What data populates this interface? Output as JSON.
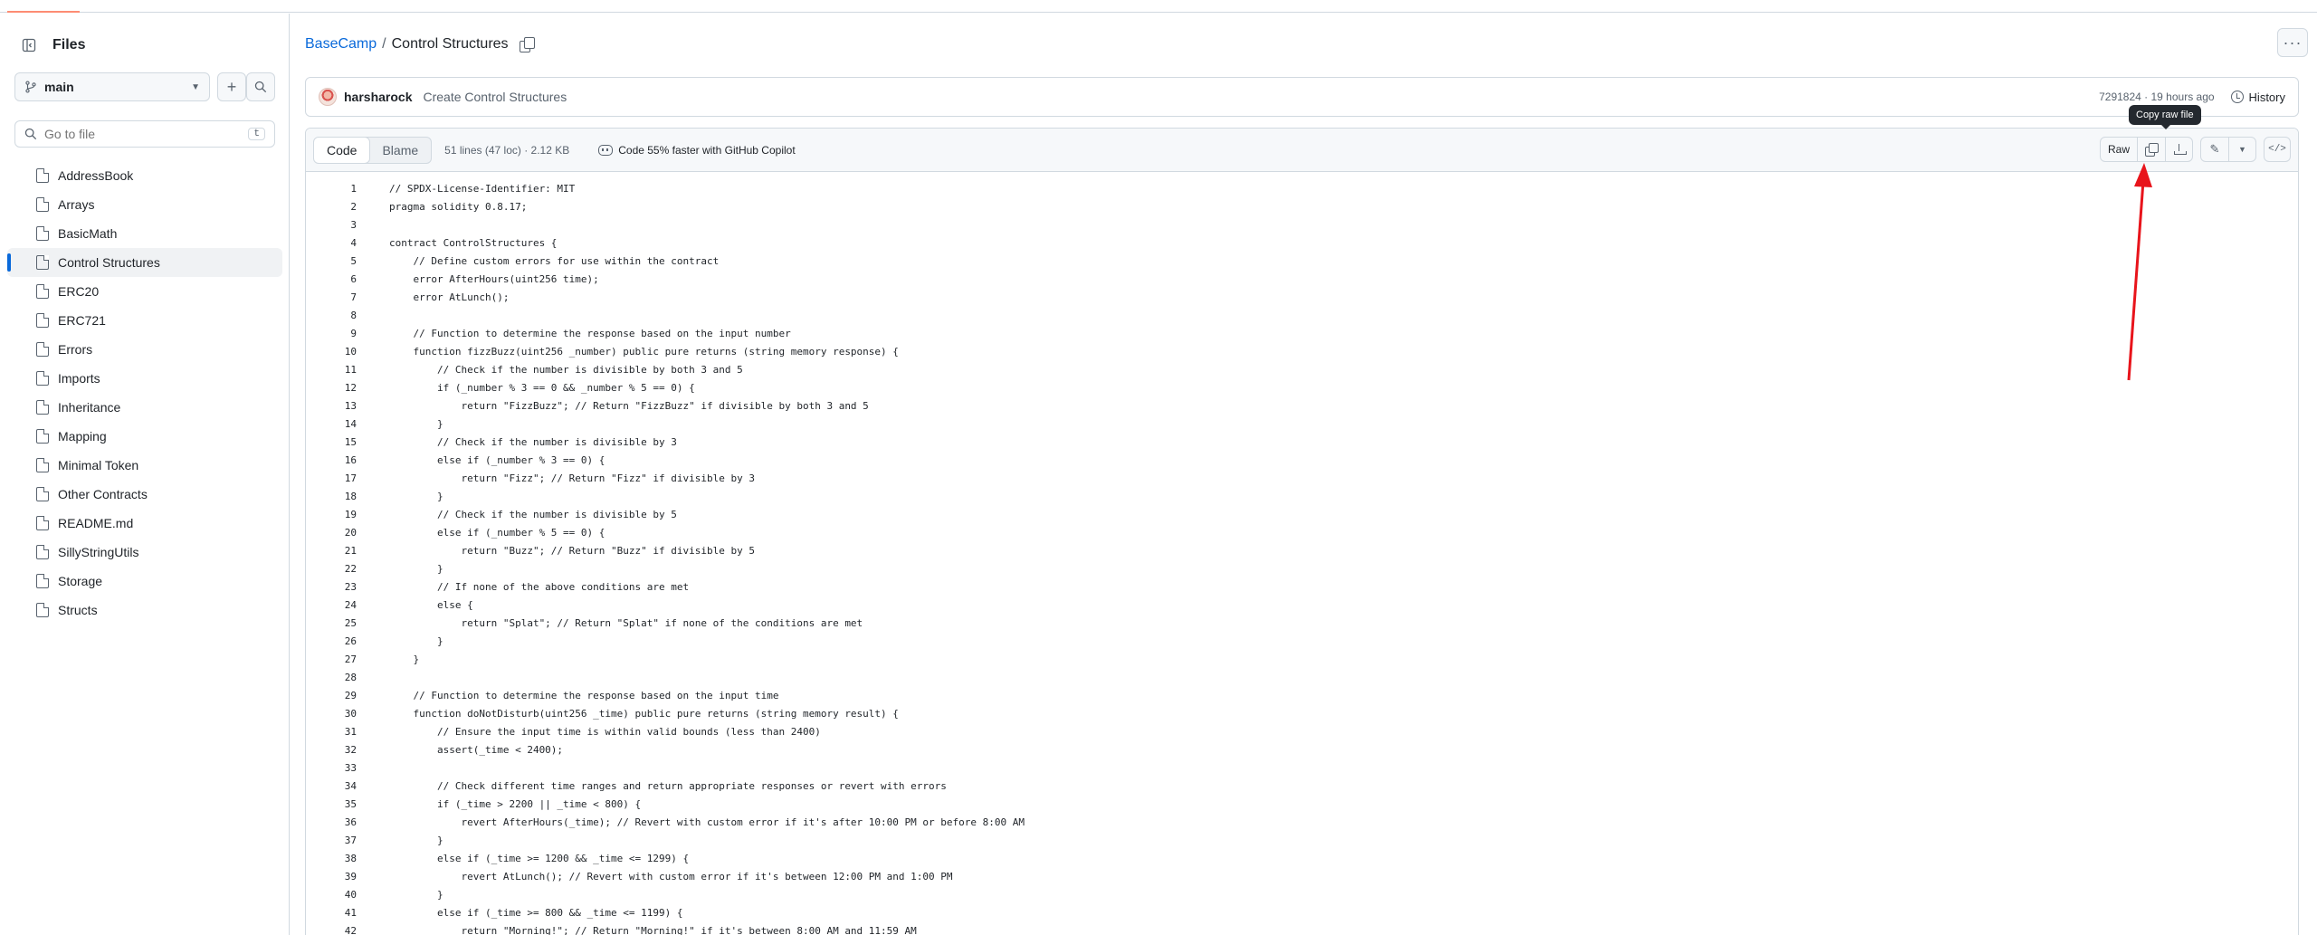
{
  "sidebar": {
    "title": "Files",
    "branch": "main",
    "goto_placeholder": "Go to file",
    "goto_kbd": "t",
    "files": [
      "AddressBook",
      "Arrays",
      "BasicMath",
      "Control Structures",
      "ERC20",
      "ERC721",
      "Errors",
      "Imports",
      "Inheritance",
      "Mapping",
      "Minimal Token",
      "Other Contracts",
      "README.md",
      "SillyStringUtils",
      "Storage",
      "Structs"
    ],
    "active_file": "Control Structures"
  },
  "breadcrumb": {
    "repo": "BaseCamp",
    "sep": "/",
    "file": "Control Structures"
  },
  "commit": {
    "author": "harsharock",
    "message": "Create Control Structures",
    "meta": "7291824 · 19 hours ago",
    "history_label": "History"
  },
  "file_header": {
    "code_tab": "Code",
    "blame_tab": "Blame",
    "stats": "51 lines (47 loc) · 2.12 KB",
    "copilot": "Code 55% faster with GitHub Copilot",
    "raw_label": "Raw",
    "tooltip": "Copy raw file"
  },
  "code_lines": [
    "// SPDX-License-Identifier: MIT",
    "pragma solidity 0.8.17;",
    "",
    "contract ControlStructures {",
    "    // Define custom errors for use within the contract",
    "    error AfterHours(uint256 time);",
    "    error AtLunch();",
    "",
    "    // Function to determine the response based on the input number",
    "    function fizzBuzz(uint256 _number) public pure returns (string memory response) {",
    "        // Check if the number is divisible by both 3 and 5",
    "        if (_number % 3 == 0 && _number % 5 == 0) {",
    "            return \"FizzBuzz\"; // Return \"FizzBuzz\" if divisible by both 3 and 5",
    "        }",
    "        // Check if the number is divisible by 3",
    "        else if (_number % 3 == 0) {",
    "            return \"Fizz\"; // Return \"Fizz\" if divisible by 3",
    "        }",
    "        // Check if the number is divisible by 5",
    "        else if (_number % 5 == 0) {",
    "            return \"Buzz\"; // Return \"Buzz\" if divisible by 5",
    "        }",
    "        // If none of the above conditions are met",
    "        else {",
    "            return \"Splat\"; // Return \"Splat\" if none of the conditions are met",
    "        }",
    "    }",
    "",
    "    // Function to determine the response based on the input time",
    "    function doNotDisturb(uint256 _time) public pure returns (string memory result) {",
    "        // Ensure the input time is within valid bounds (less than 2400)",
    "        assert(_time < 2400);",
    "",
    "        // Check different time ranges and return appropriate responses or revert with errors",
    "        if (_time > 2200 || _time < 800) {",
    "            revert AfterHours(_time); // Revert with custom error if it's after 10:00 PM or before 8:00 AM",
    "        }",
    "        else if (_time >= 1200 && _time <= 1299) {",
    "            revert AtLunch(); // Revert with custom error if it's between 12:00 PM and 1:00 PM",
    "        }",
    "        else if (_time >= 800 && _time <= 1199) {",
    "            return \"Morning!\"; // Return \"Morning!\" if it's between 8:00 AM and 11:59 AM"
  ]
}
